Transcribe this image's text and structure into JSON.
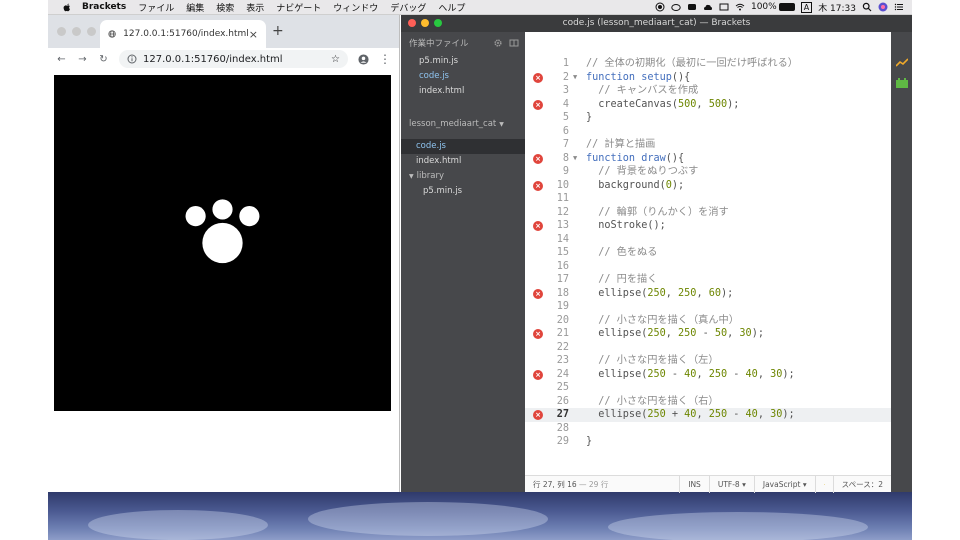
{
  "menubar": {
    "app_name": "Brackets",
    "items": [
      "ファイル",
      "編集",
      "検索",
      "表示",
      "ナビゲート",
      "ウィンドウ",
      "デバッグ",
      "ヘルプ"
    ],
    "battery": "100%",
    "input_source": "A",
    "clock": "木 17:33"
  },
  "browser": {
    "tab_title": "127.0.0.1:51760/index.html",
    "url": "127.0.0.1:51760/index.html"
  },
  "brackets": {
    "window_title": "code.js (lesson_mediaart_cat) — Brackets",
    "working_files_label": "作業中ファイル",
    "working_files": [
      "p5.min.js",
      "code.js",
      "index.html"
    ],
    "project_name": "lesson_mediaart_cat",
    "project_files": [
      "code.js",
      "index.html"
    ],
    "library_folder": "library",
    "library_files": [
      "p5.min.js"
    ]
  },
  "editor": {
    "lines": [
      {
        "n": "1",
        "err": false,
        "fold": "",
        "text": "// 全体の初期化（最初に一回だけ呼ばれる）"
      },
      {
        "n": "2",
        "err": true,
        "fold": "▼",
        "text": "function setup(){"
      },
      {
        "n": "3",
        "err": false,
        "fold": "",
        "text": "  // キャンバスを作成"
      },
      {
        "n": "4",
        "err": true,
        "fold": "",
        "text": "  createCanvas(500, 500);"
      },
      {
        "n": "5",
        "err": false,
        "fold": "",
        "text": "}"
      },
      {
        "n": "6",
        "err": false,
        "fold": "",
        "text": ""
      },
      {
        "n": "7",
        "err": false,
        "fold": "",
        "text": "// 計算と描画"
      },
      {
        "n": "8",
        "err": true,
        "fold": "▼",
        "text": "function draw(){"
      },
      {
        "n": "9",
        "err": false,
        "fold": "",
        "text": "  // 背景をぬりつぶす"
      },
      {
        "n": "10",
        "err": true,
        "fold": "",
        "text": "  background(0);"
      },
      {
        "n": "11",
        "err": false,
        "fold": "",
        "text": ""
      },
      {
        "n": "12",
        "err": false,
        "fold": "",
        "text": "  // 輪郭（りんかく）を消す"
      },
      {
        "n": "13",
        "err": true,
        "fold": "",
        "text": "  noStroke();"
      },
      {
        "n": "14",
        "err": false,
        "fold": "",
        "text": ""
      },
      {
        "n": "15",
        "err": false,
        "fold": "",
        "text": "  // 色をぬる"
      },
      {
        "n": "16",
        "err": false,
        "fold": "",
        "text": ""
      },
      {
        "n": "17",
        "err": false,
        "fold": "",
        "text": "  // 円を描く"
      },
      {
        "n": "18",
        "err": true,
        "fold": "",
        "text": "  ellipse(250, 250, 60);"
      },
      {
        "n": "19",
        "err": false,
        "fold": "",
        "text": ""
      },
      {
        "n": "20",
        "err": false,
        "fold": "",
        "text": "  // 小さな円を描く（真ん中）"
      },
      {
        "n": "21",
        "err": true,
        "fold": "",
        "text": "  ellipse(250, 250 - 50, 30);"
      },
      {
        "n": "22",
        "err": false,
        "fold": "",
        "text": ""
      },
      {
        "n": "23",
        "err": false,
        "fold": "",
        "text": "  // 小さな円を描く（左）"
      },
      {
        "n": "24",
        "err": true,
        "fold": "",
        "text": "  ellipse(250 - 40, 250 - 40, 30);"
      },
      {
        "n": "25",
        "err": false,
        "fold": "",
        "text": ""
      },
      {
        "n": "26",
        "err": false,
        "fold": "",
        "text": "  // 小さな円を描く（右）"
      },
      {
        "n": "27",
        "err": true,
        "fold": "",
        "text": "  ellipse(250 + 40, 250 - 40, 30);",
        "current": true
      },
      {
        "n": "28",
        "err": false,
        "fold": "",
        "text": ""
      },
      {
        "n": "29",
        "err": false,
        "fold": "",
        "text": "}"
      }
    ]
  },
  "statusbar": {
    "cursor": "行 27, 列 16",
    "line_count": "— 29 行",
    "mode_ins": "INS",
    "encoding": "UTF-8",
    "language": "JavaScript",
    "spaces": "スペース：2"
  },
  "colors": {
    "error_badge": "#e0453c",
    "keyword": "#446fbd",
    "number": "#6d8600",
    "sidebar_bg": "#47484b"
  }
}
